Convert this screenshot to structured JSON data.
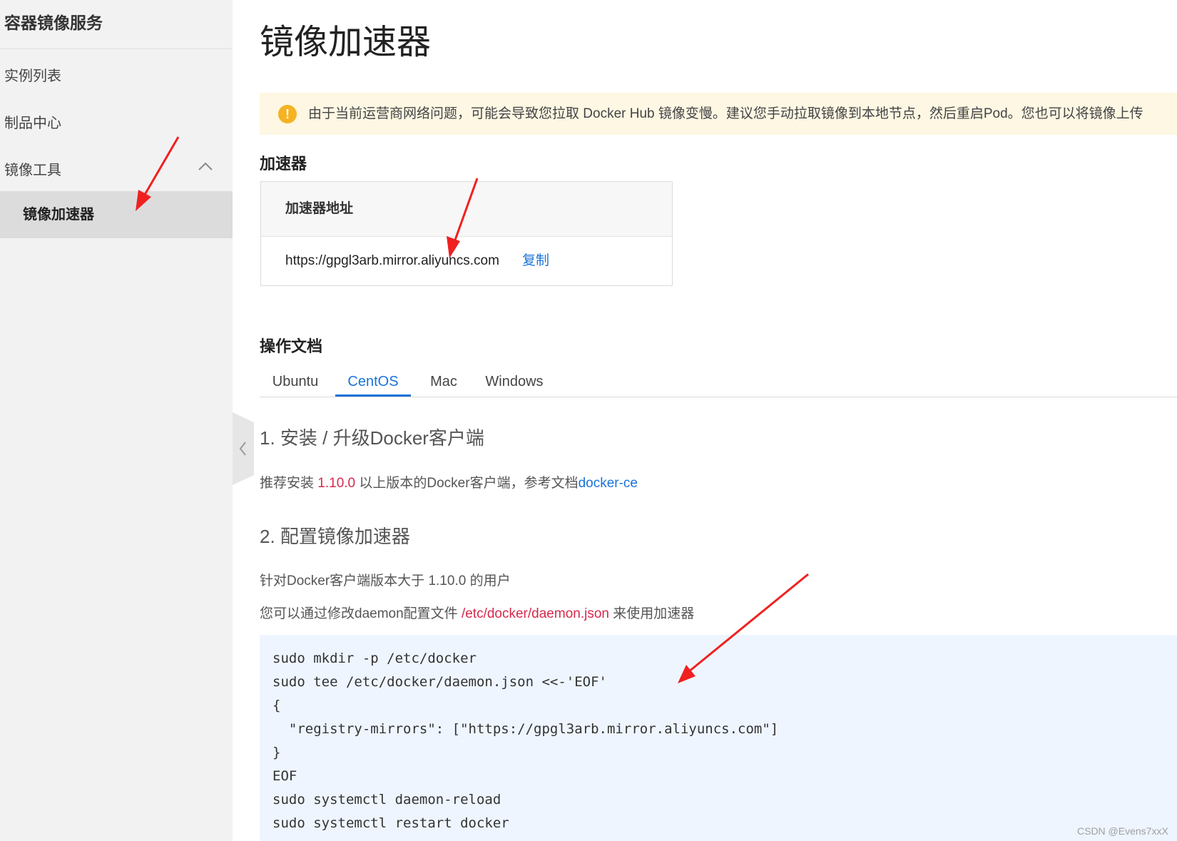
{
  "sidebar": {
    "title": "容器镜像服务",
    "items": [
      {
        "label": "实例列表"
      },
      {
        "label": "制品中心"
      },
      {
        "label": "镜像工具"
      }
    ],
    "active_item": "镜像加速器"
  },
  "page": {
    "title": "镜像加速器"
  },
  "notice": {
    "text": "由于当前运营商网络问题，可能会导致您拉取 Docker Hub 镜像变慢。建议您手动拉取镜像到本地节点，然后重启Pod。您也可以将镜像上传"
  },
  "accelerator": {
    "heading": "加速器",
    "column_header": "加速器地址",
    "url": "https://gpgl3arb.mirror.aliyuncs.com",
    "copy_label": "复制"
  },
  "docs": {
    "heading": "操作文档",
    "tabs": [
      "Ubuntu",
      "CentOS",
      "Mac",
      "Windows"
    ],
    "active_tab": "CentOS",
    "step1": {
      "title": "1. 安装 / 升级Docker客户端",
      "text_before": "推荐安装 ",
      "version": "1.10.0",
      "text_after": " 以上版本的Docker客户端，参考文档",
      "link": "docker-ce"
    },
    "step2": {
      "title": "2. 配置镜像加速器",
      "line1": "针对Docker客户端版本大于 1.10.0 的用户",
      "line2_before": "您可以通过修改daemon配置文件 ",
      "line2_path": "/etc/docker/daemon.json",
      "line2_after": " 来使用加速器"
    },
    "code_lines": [
      "sudo mkdir -p /etc/docker",
      "sudo tee /etc/docker/daemon.json <<-'EOF'",
      "{",
      "  \"registry-mirrors\": [\"https://gpgl3arb.mirror.aliyuncs.com\"]",
      "}",
      "EOF",
      "sudo systemctl daemon-reload",
      "sudo systemctl restart docker"
    ]
  },
  "watermark": "CSDN @Evens7xxX",
  "colors": {
    "accent": "#1a73d9",
    "highlight": "#d6294b",
    "notice_bg": "#fdf7e3",
    "warning_icon": "#f5b322",
    "code_bg": "#eef5fe",
    "annotation_arrow": "#f02020"
  }
}
